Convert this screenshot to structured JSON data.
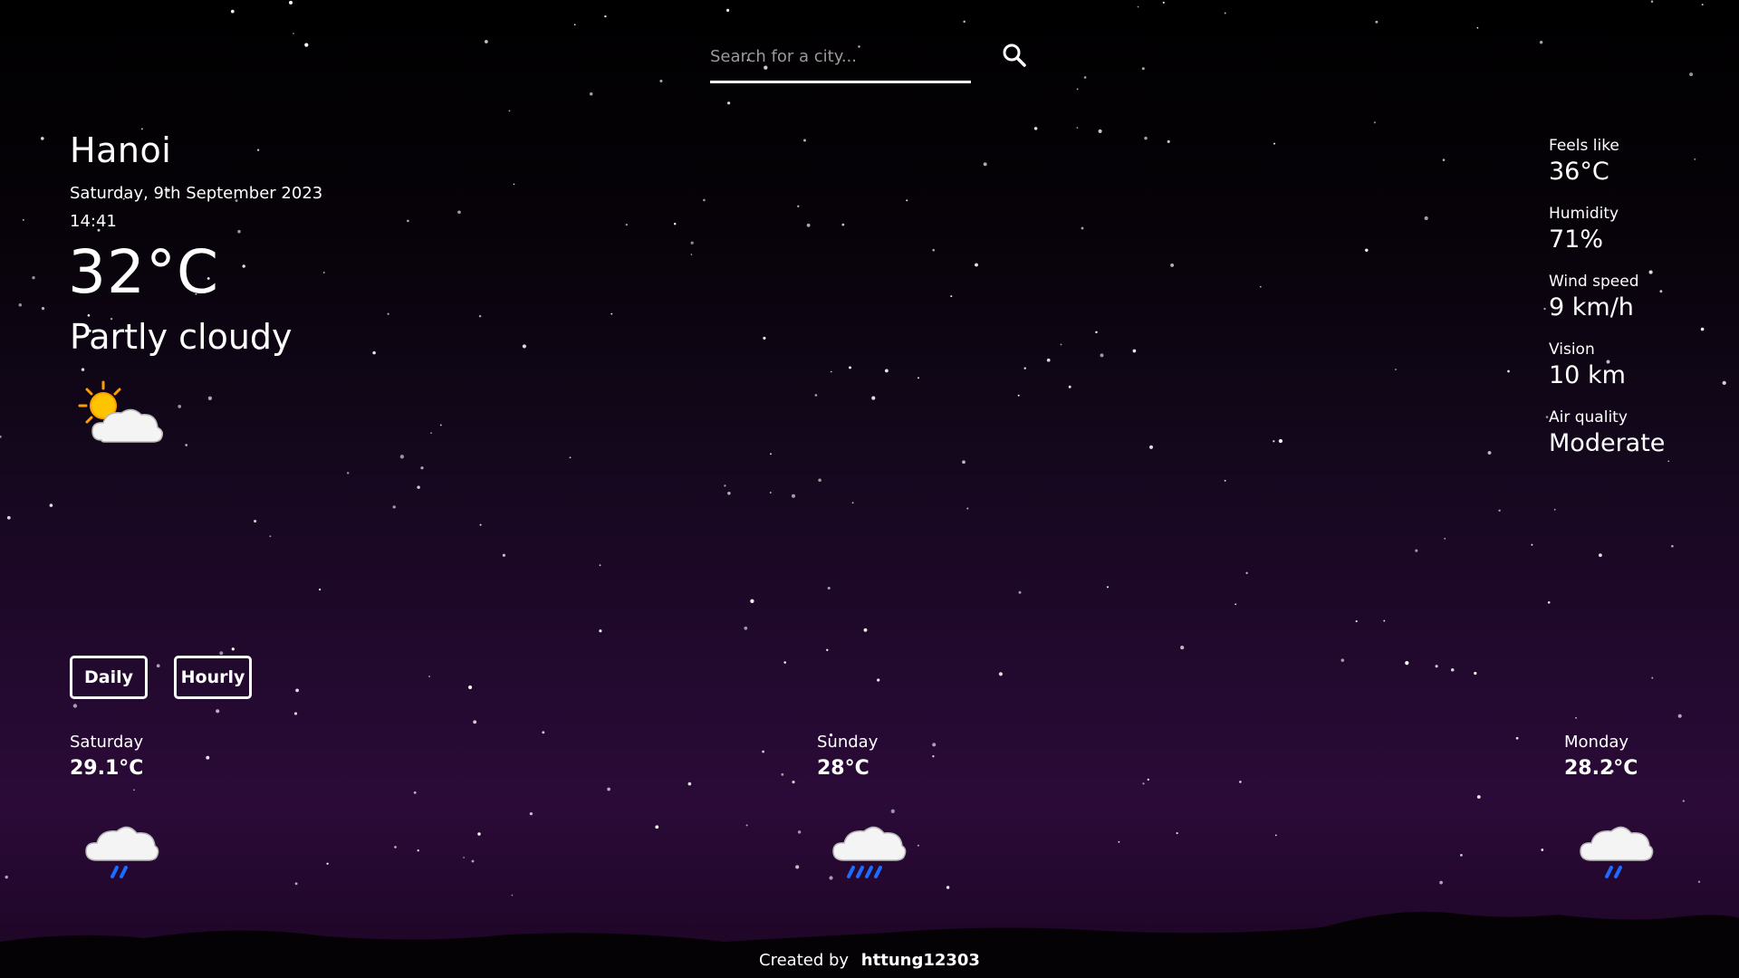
{
  "search": {
    "placeholder": "Search for a city..."
  },
  "current": {
    "city": "Hanoi",
    "date": "Saturday, 9th September 2023",
    "time": "14:41",
    "temperature": "32°C",
    "condition": "Partly cloudy",
    "icon": "partly-cloudy-icon"
  },
  "details": [
    {
      "label": "Feels like",
      "value": "36°C"
    },
    {
      "label": "Humidity",
      "value": "71%"
    },
    {
      "label": "Wind speed",
      "value": "9 km/h"
    },
    {
      "label": "Vision",
      "value": "10 km"
    },
    {
      "label": "Air quality",
      "value": "Moderate"
    }
  ],
  "toggle": {
    "daily": "Daily",
    "hourly": "Hourly"
  },
  "forecast": [
    {
      "day": "Saturday",
      "temp": "29.1°C",
      "icon": "light-rain-icon"
    },
    {
      "day": "Sunday",
      "temp": "28°C",
      "icon": "moderate-rain-icon"
    },
    {
      "day": "Monday",
      "temp": "28.2°C",
      "icon": "light-rain-icon"
    }
  ],
  "footer": {
    "text": "Created by",
    "author": "httung12303"
  },
  "colors": {
    "background_top": "#000000",
    "background_bottom": "#2b0a38",
    "accent": "#ffffff",
    "rain": "#1e6cff",
    "sun": "#ffc400"
  }
}
